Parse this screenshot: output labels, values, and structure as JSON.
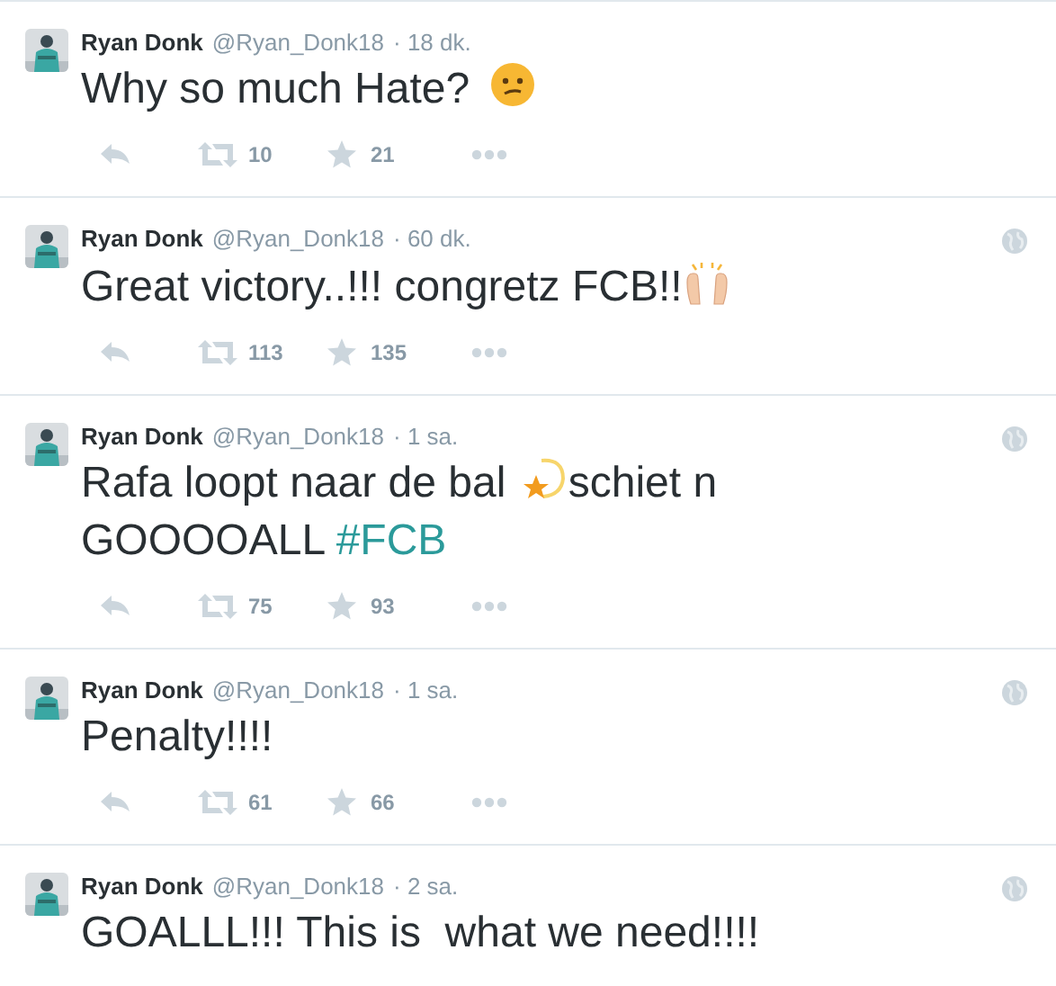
{
  "tweets": [
    {
      "name": "Ryan Donk",
      "handle": "@Ryan_Donk18",
      "time": "· 18 dk.",
      "geo": false,
      "lines": [
        [
          {
            "kind": "text",
            "value": "Why so much Hate? "
          },
          {
            "kind": "confused-emoji"
          }
        ]
      ],
      "retweets": "10",
      "favorites": "21"
    },
    {
      "name": "Ryan Donk",
      "handle": "@Ryan_Donk18",
      "time": "· 60 dk.",
      "geo": true,
      "lines": [
        [
          {
            "kind": "text",
            "value": "Great victory..!!! congretz FCB!!"
          },
          {
            "kind": "hands-emoji"
          }
        ]
      ],
      "retweets": "113",
      "favorites": "135"
    },
    {
      "name": "Ryan Donk",
      "handle": "@Ryan_Donk18",
      "time": "· 1 sa.",
      "geo": true,
      "lines": [
        [
          {
            "kind": "text",
            "value": "Rafa loopt naar de bal "
          },
          {
            "kind": "dizzy-emoji"
          },
          {
            "kind": "text",
            "value": "schiet n"
          }
        ],
        [
          {
            "kind": "text",
            "value": "GOOOOALL "
          },
          {
            "kind": "hashtag",
            "value": "#FCB"
          }
        ]
      ],
      "retweets": "75",
      "favorites": "93"
    },
    {
      "name": "Ryan Donk",
      "handle": "@Ryan_Donk18",
      "time": "· 1 sa.",
      "geo": true,
      "lines": [
        [
          {
            "kind": "text",
            "value": "Penalty!!!!"
          }
        ]
      ],
      "retweets": "61",
      "favorites": "66"
    },
    {
      "name": "Ryan Donk",
      "handle": "@Ryan_Donk18",
      "time": "· 2 sa.",
      "geo": true,
      "lines": [
        [
          {
            "kind": "text",
            "value": "GOALLL!!! This is  what we need!!!!"
          }
        ]
      ]
    }
  ]
}
